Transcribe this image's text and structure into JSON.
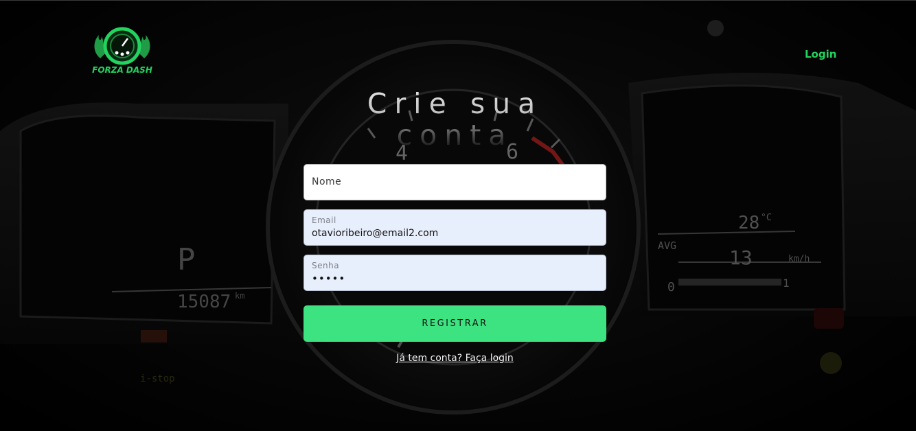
{
  "header": {
    "logo_text": "FORZA DASH",
    "nav_login_label": "Login"
  },
  "title": "Crie sua conta",
  "form": {
    "name_field": {
      "label": "Nome",
      "value": ""
    },
    "email_field": {
      "label": "Email",
      "value": "otavioribeiro@email2.com"
    },
    "password_field": {
      "label": "Senha",
      "value": "•••••"
    },
    "register_button_label": "REGISTRAR",
    "login_link_label": "Já tem conta? Faça login"
  },
  "background": {
    "dash_texts": [
      "4",
      "6",
      "P",
      "15087",
      "km",
      "28",
      "°C",
      "AVG",
      "13",
      "km/h",
      "0",
      "1",
      "i-stop"
    ]
  },
  "colors": {
    "accent": "#23d35f",
    "button": "#3de381",
    "filled_input": "#e8effc"
  }
}
